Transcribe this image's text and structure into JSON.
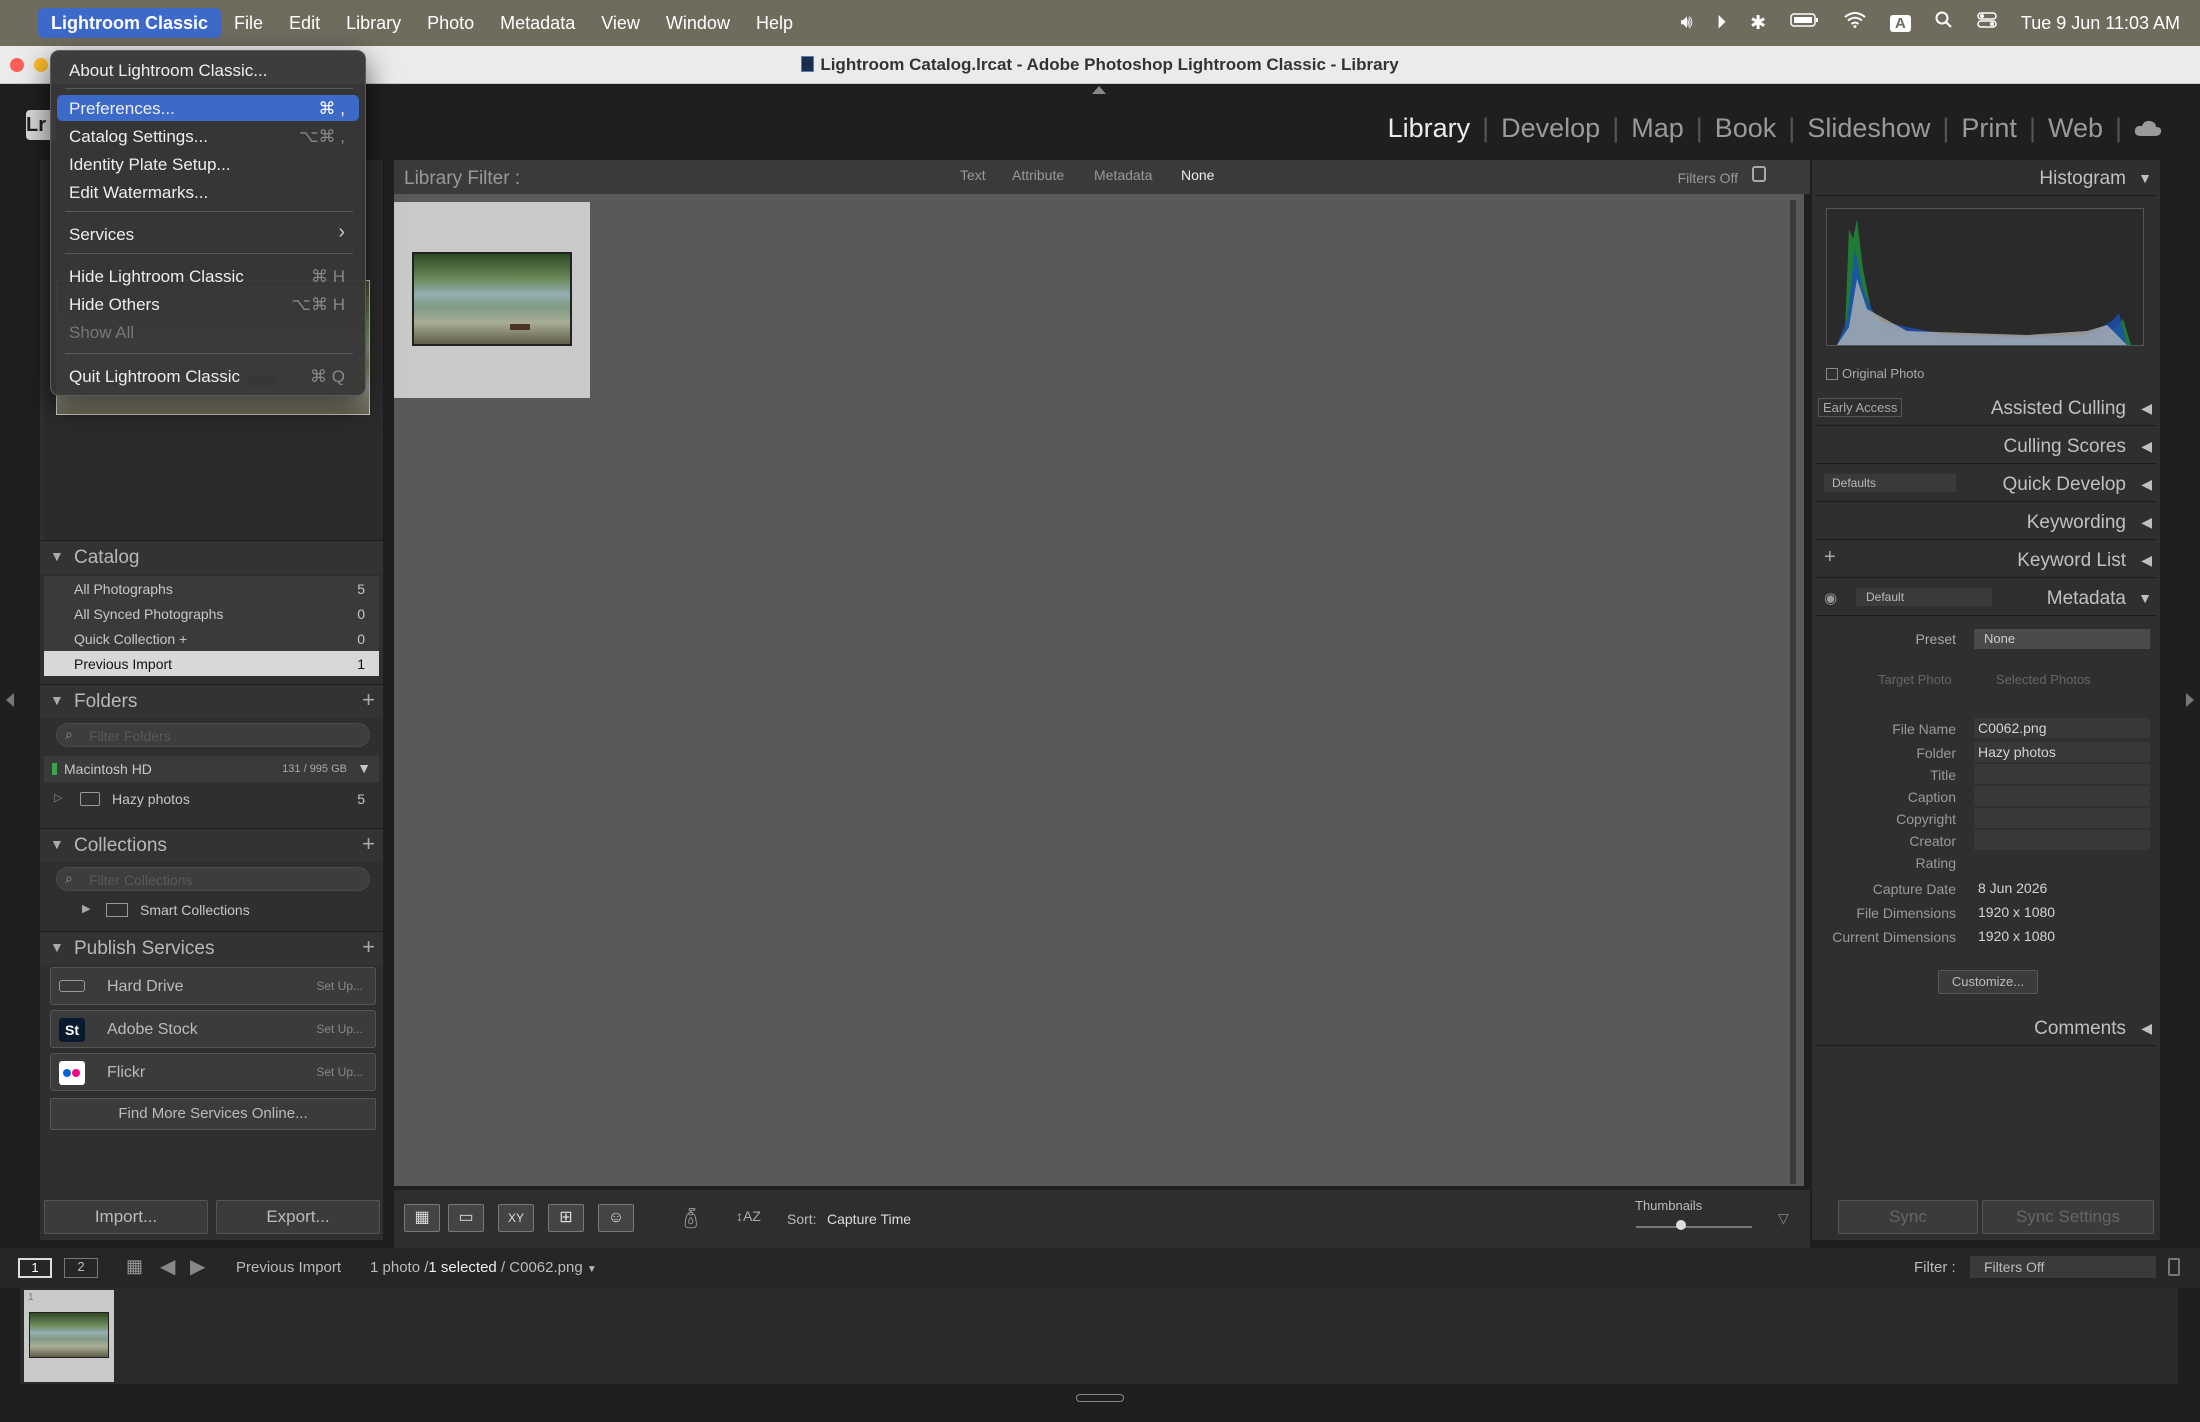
{
  "menubar": {
    "apple": "",
    "items": [
      "Lightroom Classic",
      "File",
      "Edit",
      "Library",
      "Photo",
      "Metadata",
      "View",
      "Window",
      "Help"
    ],
    "datetime": "Tue 9 Jun  11:03 AM",
    "input_source": "A"
  },
  "window": {
    "title": "Lightroom Catalog.lrcat - Adobe Photoshop Lightroom Classic - Library"
  },
  "app_menu": {
    "items": [
      {
        "label": "About Lightroom Classic...",
        "shortcut": ""
      },
      {
        "label": "Preferences...",
        "shortcut": "⌘ ,"
      },
      {
        "label": "Catalog Settings...",
        "shortcut": "⌥⌘ ,"
      },
      {
        "label": "Identity Plate Setup...",
        "shortcut": ""
      },
      {
        "label": "Edit Watermarks...",
        "shortcut": ""
      },
      {
        "label": "Services",
        "shortcut": "›"
      },
      {
        "label": "Hide Lightroom Classic",
        "shortcut": "⌘ H"
      },
      {
        "label": "Hide Others",
        "shortcut": "⌥⌘ H"
      },
      {
        "label": "Show All",
        "shortcut": ""
      },
      {
        "label": "Quit Lightroom Classic",
        "shortcut": "⌘ Q"
      }
    ]
  },
  "modules": [
    "Library",
    "Develop",
    "Map",
    "Book",
    "Slideshow",
    "Print",
    "Web"
  ],
  "left": {
    "catalog": {
      "title": "Catalog",
      "rows": [
        {
          "label": "All Photographs",
          "count": "5"
        },
        {
          "label": "All Synced Photographs",
          "count": "0"
        },
        {
          "label": "Quick Collection +",
          "count": "0"
        },
        {
          "label": "Previous Import",
          "count": "1"
        }
      ]
    },
    "folders": {
      "title": "Folders",
      "filter_placeholder": "Filter Folders",
      "volume": {
        "label": "Macintosh HD",
        "size": "131 / 995 GB"
      },
      "folder": {
        "label": "Hazy photos",
        "count": "5"
      }
    },
    "collections": {
      "title": "Collections",
      "filter_placeholder": "Filter Collections",
      "smart": "Smart Collections"
    },
    "publish": {
      "title": "Publish Services",
      "services": [
        {
          "name": "Hard Drive",
          "action": "Set Up..."
        },
        {
          "name": "Adobe Stock",
          "action": "Set Up...",
          "icon": "St"
        },
        {
          "name": "Flickr",
          "action": "Set Up..."
        }
      ],
      "find_more": "Find More Services Online..."
    },
    "import_label": "Import...",
    "export_label": "Export..."
  },
  "filter_bar": {
    "title": "Library Filter :",
    "tabs": [
      "Text",
      "Attribute",
      "Metadata",
      "None"
    ],
    "status": "Filters Off"
  },
  "toolbar": {
    "sort_label": "Sort:",
    "sort_value": "Capture Time",
    "thumb_label": "Thumbnails"
  },
  "right": {
    "histogram": {
      "title": "Histogram",
      "original": "Original Photo"
    },
    "assisted": {
      "badge": "Early Access",
      "title": "Assisted Culling"
    },
    "culling": "Culling Scores",
    "quick": {
      "preset": "Defaults",
      "title": "Quick Develop"
    },
    "keywording": "Keywording",
    "keyword_list": "Keyword List",
    "metadata": {
      "preset_select": "Default",
      "title": "Metadata",
      "preset_label": "Preset",
      "preset_value": "None",
      "target": "Target Photo",
      "selected": "Selected Photos",
      "fields": [
        {
          "k": "File Name",
          "v": "C0062.png"
        },
        {
          "k": "Folder",
          "v": "Hazy photos"
        },
        {
          "k": "Title",
          "v": ""
        },
        {
          "k": "Caption",
          "v": ""
        },
        {
          "k": "Copyright",
          "v": ""
        },
        {
          "k": "Creator",
          "v": ""
        },
        {
          "k": "Rating",
          "v": ""
        },
        {
          "k": "Capture Date",
          "v": "8 Jun 2026"
        },
        {
          "k": "File Dimensions",
          "v": "1920 x 1080"
        },
        {
          "k": "Current Dimensions",
          "v": "1920 x 1080"
        }
      ],
      "customize": "Customize..."
    },
    "comments": "Comments",
    "sync": "Sync",
    "sync_settings": "Sync Settings"
  },
  "filmstrip": {
    "page1": "1",
    "page2": "2",
    "source": "Previous Import",
    "count": "1 photo /",
    "selected": "1 selected",
    "file": "/ C0062.png",
    "filter_label": "Filter :",
    "filter_value": "Filters Off",
    "thumb_index": "1"
  }
}
